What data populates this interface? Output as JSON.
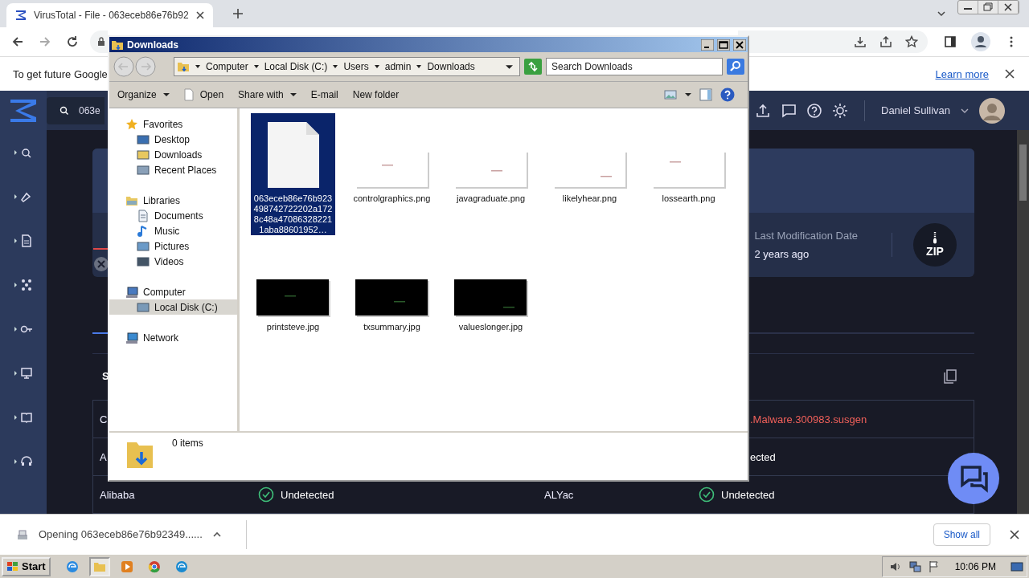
{
  "browser": {
    "tab": {
      "title": "VirusTotal - File - 063eceb86e76b92"
    },
    "infobar": {
      "text": "To get future Google",
      "link": "Learn more"
    }
  },
  "virustotal": {
    "search": {
      "value": "063e"
    },
    "user": {
      "name": "Daniel Sullivan"
    },
    "card": {
      "label": "Last Modification Date",
      "value": "2 years ago",
      "file_type": "ZIP"
    },
    "section_title": "S",
    "detections": [
      {
        "kind": "covered",
        "left_engine": "C",
        "right_result": {
          "kind": "malicious",
          "text": ".Malware.300983.susgen"
        }
      },
      {
        "kind": "covered",
        "left_engine": "A",
        "right_result": {
          "kind": "undetected",
          "text": "ected"
        }
      },
      {
        "kind": "full",
        "left_engine": "Alibaba",
        "left_result": {
          "kind": "undetected",
          "text": "Undetected"
        },
        "right_engine": "ALYac",
        "right_result": {
          "kind": "undetected",
          "text": "Undetected"
        }
      }
    ]
  },
  "explorer": {
    "title": "Downloads",
    "breadcrumb": [
      "Computer",
      "Local Disk (C:)",
      "Users",
      "admin",
      "Downloads"
    ],
    "search": {
      "placeholder": "Search Downloads"
    },
    "commands": [
      {
        "label": "Organize",
        "dropdown": true,
        "icon": false
      },
      {
        "label": "Open",
        "dropdown": false,
        "icon": true
      },
      {
        "label": "Share with",
        "dropdown": true,
        "icon": false
      },
      {
        "label": "E-mail",
        "dropdown": false,
        "icon": false
      },
      {
        "label": "New folder",
        "dropdown": false,
        "icon": false
      }
    ],
    "nav": [
      {
        "label": "Favorites",
        "kind": "favorites",
        "selected": false,
        "children": [
          {
            "label": "Desktop",
            "kind": "desktop",
            "selected": false
          },
          {
            "label": "Downloads",
            "kind": "downloads",
            "selected": false
          },
          {
            "label": "Recent Places",
            "kind": "recent",
            "selected": false
          }
        ]
      },
      {
        "label": "Libraries",
        "kind": "libraries",
        "selected": false,
        "children": [
          {
            "label": "Documents",
            "kind": "documents",
            "selected": false
          },
          {
            "label": "Music",
            "kind": "music",
            "selected": false
          },
          {
            "label": "Pictures",
            "kind": "pictures",
            "selected": false
          },
          {
            "label": "Videos",
            "kind": "videos",
            "selected": false
          }
        ]
      },
      {
        "label": "Computer",
        "kind": "computer",
        "selected": false,
        "children": [
          {
            "label": "Local Disk (C:)",
            "kind": "disk",
            "selected": true
          }
        ]
      },
      {
        "label": "Network",
        "kind": "network",
        "selected": false
      }
    ],
    "files": [
      {
        "name": "063eceb86e76b923498742722202a1728c48a470863282211aba88601952…",
        "kind": "document",
        "selected": true
      },
      {
        "name": "controlgraphics.png",
        "kind": "light",
        "selected": false
      },
      {
        "name": "javagraduate.png",
        "kind": "light",
        "selected": false
      },
      {
        "name": "likelyhear.png",
        "kind": "light",
        "selected": false
      },
      {
        "name": "lossearth.png",
        "kind": "light",
        "selected": false
      },
      {
        "name": "printsteve.jpg",
        "kind": "dark",
        "selected": false
      },
      {
        "name": "txsummary.jpg",
        "kind": "dark",
        "selected": false
      },
      {
        "name": "valueslonger.jpg",
        "kind": "dark",
        "selected": false
      }
    ],
    "status": "0 items"
  },
  "download_bar": {
    "item": "Opening 063eceb86e76b92349......",
    "button": "Show all"
  },
  "taskbar": {
    "start": "Start",
    "apps": [
      {
        "kind": "ie",
        "selected": false
      },
      {
        "kind": "explorer",
        "selected": true
      },
      {
        "kind": "media",
        "selected": false
      },
      {
        "kind": "chrome",
        "selected": false
      },
      {
        "kind": "edge",
        "selected": false
      }
    ],
    "clock": "10:06 PM"
  }
}
